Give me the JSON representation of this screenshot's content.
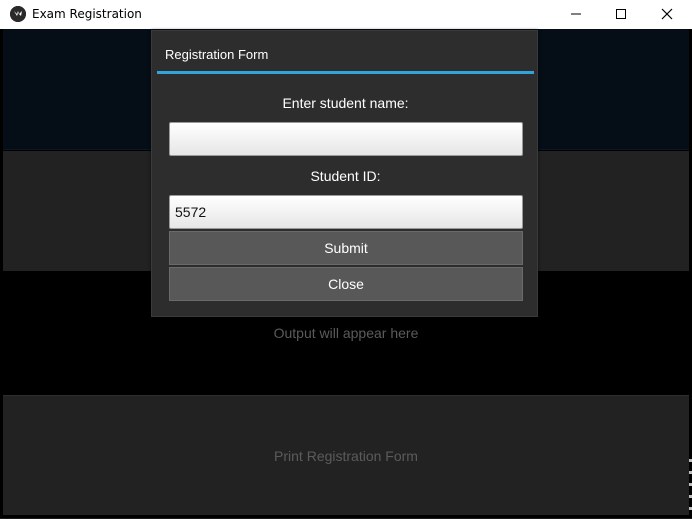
{
  "window": {
    "title": "Exam Registration",
    "icons": {
      "app": "kivy-icon",
      "minimize": "minimize-icon",
      "maximize": "maximize-icon",
      "close": "close-icon"
    }
  },
  "app": {
    "output_text": "Output will appear here",
    "print_button_label": "Print Registration Form"
  },
  "popup": {
    "title": "Registration Form",
    "name_label": "Enter student name:",
    "name_value": "",
    "id_label": "Student ID:",
    "id_value": "5572",
    "submit_label": "Submit",
    "close_label": "Close"
  },
  "colors": {
    "accent": "#33a3dc",
    "popup_bg": "#2d2d2d",
    "button_bg": "#585858",
    "muted_text": "#5b5b5b"
  }
}
